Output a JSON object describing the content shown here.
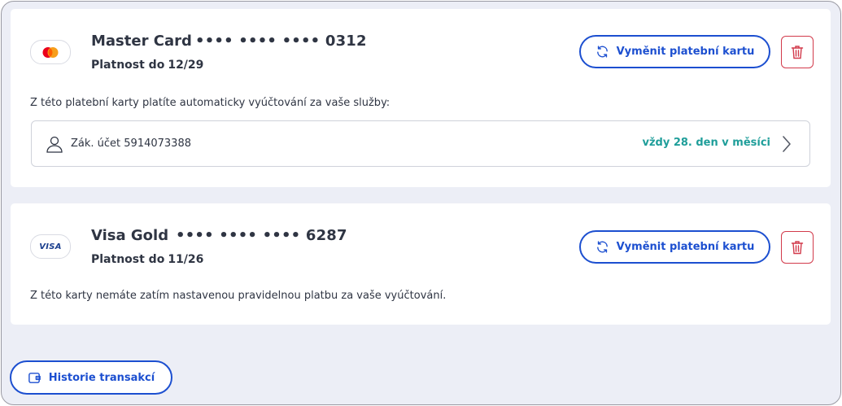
{
  "cards": [
    {
      "logo": "mastercard-logo",
      "name": "Master Card",
      "number": "•••• •••• •••• 0312",
      "validity_label": "Platnost do",
      "validity_value": "12/29",
      "note": "Z této platební karty platíte automaticky vyúčtování za vaše služby:",
      "replace_label": "Vyměnit platební kartu",
      "replace_icon": "refresh-icon",
      "delete_icon": "trash-icon",
      "payment": {
        "icon": "user-icon",
        "account": "Zák. účet 5914073388",
        "schedule": "vždy 28. den v měsíci",
        "chevron_icon": "chevron-right-icon"
      }
    },
    {
      "logo_text": "VISA",
      "name": "Visa Gold",
      "number": "•••• •••• •••• 6287",
      "validity_label": "Platnost do",
      "validity_value": "11/26",
      "note": "Z této karty nemáte zatím nastavenou pravidelnou platbu za vaše vyúčtování.",
      "replace_label": "Vyměnit platební kartu",
      "replace_icon": "refresh-icon",
      "delete_icon": "trash-icon"
    }
  ],
  "history_button": {
    "label": "Historie transakcí",
    "icon": "wallet-icon"
  },
  "colors": {
    "primary": "#1c4fd0",
    "danger": "#d23a4b",
    "teal": "#1f9e9a",
    "text": "#2f3543",
    "background": "#eceef6"
  }
}
